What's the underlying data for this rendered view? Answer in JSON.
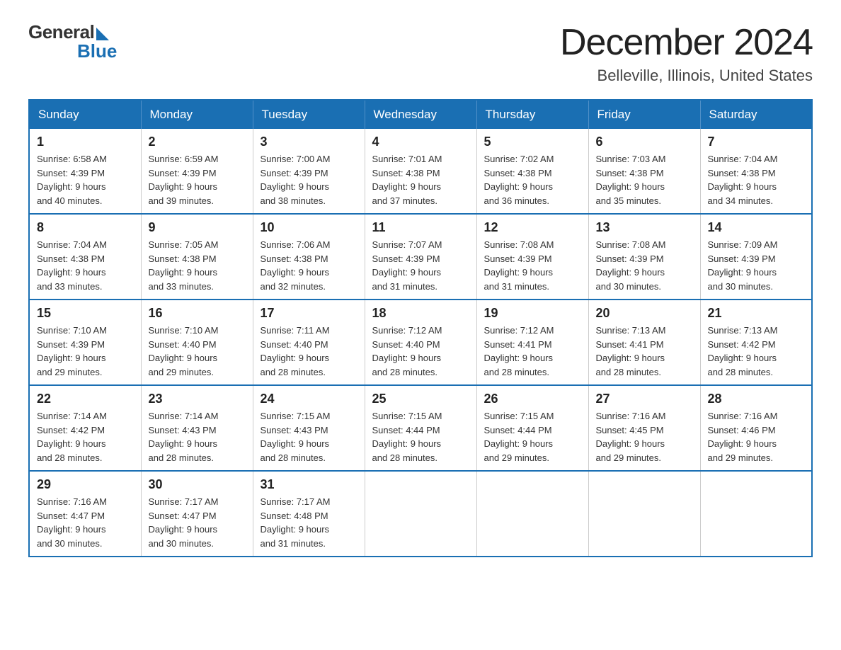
{
  "logo": {
    "general": "General",
    "blue": "Blue"
  },
  "header": {
    "month": "December 2024",
    "location": "Belleville, Illinois, United States"
  },
  "weekdays": [
    "Sunday",
    "Monday",
    "Tuesday",
    "Wednesday",
    "Thursday",
    "Friday",
    "Saturday"
  ],
  "weeks": [
    [
      {
        "day": "1",
        "sunrise": "6:58 AM",
        "sunset": "4:39 PM",
        "daylight": "9 hours and 40 minutes."
      },
      {
        "day": "2",
        "sunrise": "6:59 AM",
        "sunset": "4:39 PM",
        "daylight": "9 hours and 39 minutes."
      },
      {
        "day": "3",
        "sunrise": "7:00 AM",
        "sunset": "4:39 PM",
        "daylight": "9 hours and 38 minutes."
      },
      {
        "day": "4",
        "sunrise": "7:01 AM",
        "sunset": "4:38 PM",
        "daylight": "9 hours and 37 minutes."
      },
      {
        "day": "5",
        "sunrise": "7:02 AM",
        "sunset": "4:38 PM",
        "daylight": "9 hours and 36 minutes."
      },
      {
        "day": "6",
        "sunrise": "7:03 AM",
        "sunset": "4:38 PM",
        "daylight": "9 hours and 35 minutes."
      },
      {
        "day": "7",
        "sunrise": "7:04 AM",
        "sunset": "4:38 PM",
        "daylight": "9 hours and 34 minutes."
      }
    ],
    [
      {
        "day": "8",
        "sunrise": "7:04 AM",
        "sunset": "4:38 PM",
        "daylight": "9 hours and 33 minutes."
      },
      {
        "day": "9",
        "sunrise": "7:05 AM",
        "sunset": "4:38 PM",
        "daylight": "9 hours and 33 minutes."
      },
      {
        "day": "10",
        "sunrise": "7:06 AM",
        "sunset": "4:38 PM",
        "daylight": "9 hours and 32 minutes."
      },
      {
        "day": "11",
        "sunrise": "7:07 AM",
        "sunset": "4:39 PM",
        "daylight": "9 hours and 31 minutes."
      },
      {
        "day": "12",
        "sunrise": "7:08 AM",
        "sunset": "4:39 PM",
        "daylight": "9 hours and 31 minutes."
      },
      {
        "day": "13",
        "sunrise": "7:08 AM",
        "sunset": "4:39 PM",
        "daylight": "9 hours and 30 minutes."
      },
      {
        "day": "14",
        "sunrise": "7:09 AM",
        "sunset": "4:39 PM",
        "daylight": "9 hours and 30 minutes."
      }
    ],
    [
      {
        "day": "15",
        "sunrise": "7:10 AM",
        "sunset": "4:39 PM",
        "daylight": "9 hours and 29 minutes."
      },
      {
        "day": "16",
        "sunrise": "7:10 AM",
        "sunset": "4:40 PM",
        "daylight": "9 hours and 29 minutes."
      },
      {
        "day": "17",
        "sunrise": "7:11 AM",
        "sunset": "4:40 PM",
        "daylight": "9 hours and 28 minutes."
      },
      {
        "day": "18",
        "sunrise": "7:12 AM",
        "sunset": "4:40 PM",
        "daylight": "9 hours and 28 minutes."
      },
      {
        "day": "19",
        "sunrise": "7:12 AM",
        "sunset": "4:41 PM",
        "daylight": "9 hours and 28 minutes."
      },
      {
        "day": "20",
        "sunrise": "7:13 AM",
        "sunset": "4:41 PM",
        "daylight": "9 hours and 28 minutes."
      },
      {
        "day": "21",
        "sunrise": "7:13 AM",
        "sunset": "4:42 PM",
        "daylight": "9 hours and 28 minutes."
      }
    ],
    [
      {
        "day": "22",
        "sunrise": "7:14 AM",
        "sunset": "4:42 PM",
        "daylight": "9 hours and 28 minutes."
      },
      {
        "day": "23",
        "sunrise": "7:14 AM",
        "sunset": "4:43 PM",
        "daylight": "9 hours and 28 minutes."
      },
      {
        "day": "24",
        "sunrise": "7:15 AM",
        "sunset": "4:43 PM",
        "daylight": "9 hours and 28 minutes."
      },
      {
        "day": "25",
        "sunrise": "7:15 AM",
        "sunset": "4:44 PM",
        "daylight": "9 hours and 28 minutes."
      },
      {
        "day": "26",
        "sunrise": "7:15 AM",
        "sunset": "4:44 PM",
        "daylight": "9 hours and 29 minutes."
      },
      {
        "day": "27",
        "sunrise": "7:16 AM",
        "sunset": "4:45 PM",
        "daylight": "9 hours and 29 minutes."
      },
      {
        "day": "28",
        "sunrise": "7:16 AM",
        "sunset": "4:46 PM",
        "daylight": "9 hours and 29 minutes."
      }
    ],
    [
      {
        "day": "29",
        "sunrise": "7:16 AM",
        "sunset": "4:47 PM",
        "daylight": "9 hours and 30 minutes."
      },
      {
        "day": "30",
        "sunrise": "7:17 AM",
        "sunset": "4:47 PM",
        "daylight": "9 hours and 30 minutes."
      },
      {
        "day": "31",
        "sunrise": "7:17 AM",
        "sunset": "4:48 PM",
        "daylight": "9 hours and 31 minutes."
      },
      null,
      null,
      null,
      null
    ]
  ],
  "labels": {
    "sunrise": "Sunrise:",
    "sunset": "Sunset:",
    "daylight": "Daylight:"
  }
}
